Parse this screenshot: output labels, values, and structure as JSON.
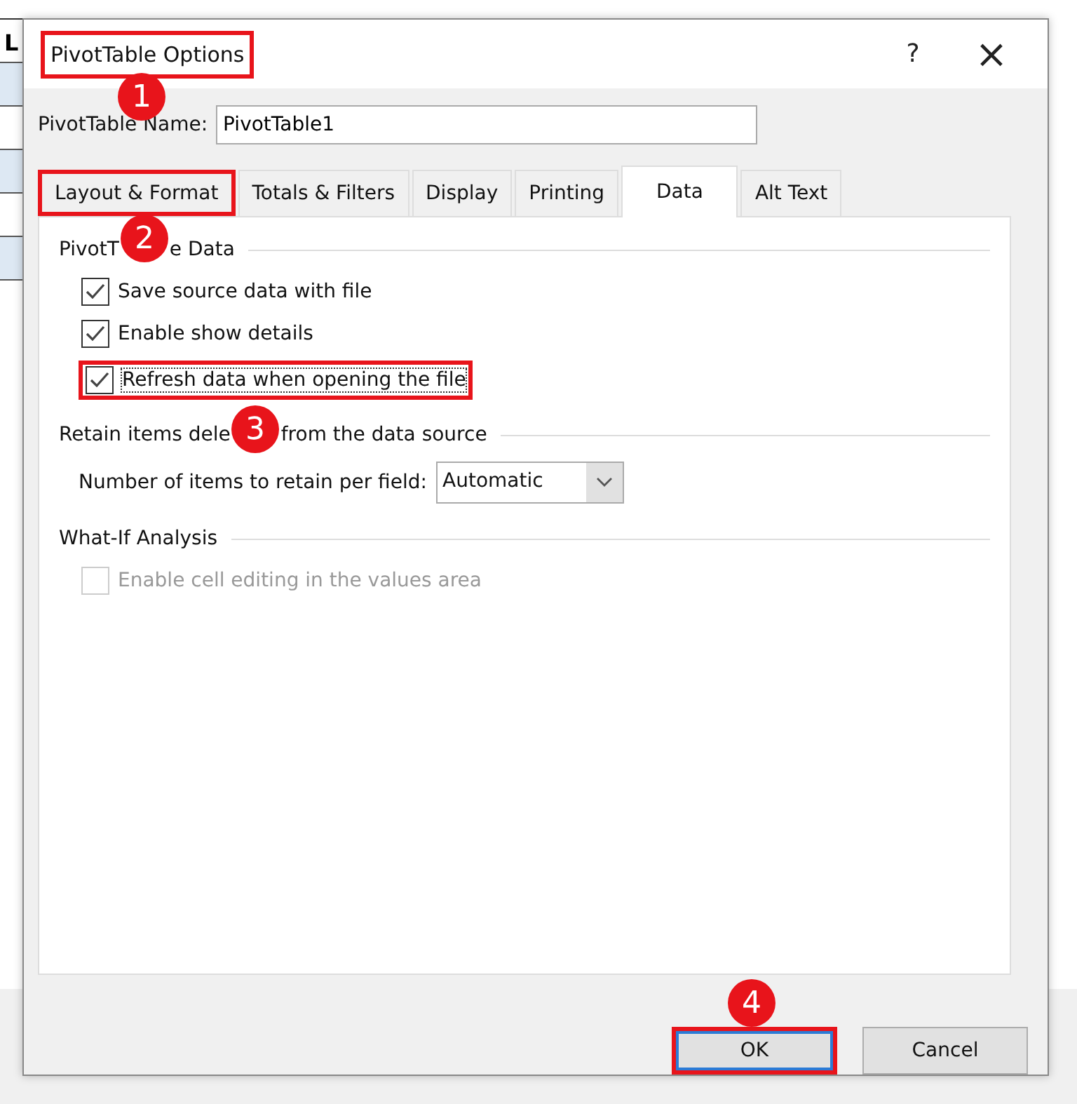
{
  "sheet": {
    "header_cell": "L"
  },
  "dialog": {
    "title": "PivotTable Options",
    "title_highlighted": true,
    "help": "?",
    "close": "×",
    "name_label": "PivotTable Name:",
    "name_value": "PivotTable1",
    "tabs": [
      {
        "label": "Layout & Format",
        "selected": false,
        "highlighted": true
      },
      {
        "label": "Totals & Filters",
        "selected": false,
        "highlighted": false
      },
      {
        "label": "Display",
        "selected": false,
        "highlighted": false
      },
      {
        "label": "Printing",
        "selected": false,
        "highlighted": false
      },
      {
        "label": "Data",
        "selected": true,
        "highlighted": false
      },
      {
        "label": "Alt Text",
        "selected": false,
        "highlighted": false
      }
    ],
    "sections": [
      {
        "title_parts": [
          "PivotT",
          "e Data"
        ],
        "items": [
          {
            "kind": "checkbox",
            "label": "Save source data with file",
            "checked": true,
            "disabled": false,
            "focused": false,
            "highlighted": false
          },
          {
            "kind": "checkbox",
            "label": "Enable show details",
            "checked": true,
            "disabled": false,
            "focused": false,
            "highlighted": false
          },
          {
            "kind": "checkbox",
            "label": "Refresh data when opening the file",
            "checked": true,
            "disabled": false,
            "focused": true,
            "highlighted": true
          }
        ]
      },
      {
        "title_parts": [
          "Retain items dele",
          "from the data source"
        ],
        "items": [
          {
            "kind": "dropdown",
            "label": "Number of items to retain per field:",
            "value": "Automatic"
          }
        ]
      },
      {
        "title_parts": [
          "What-If Analysis"
        ],
        "items": [
          {
            "kind": "checkbox",
            "label": "Enable cell editing in the values area",
            "checked": false,
            "disabled": true,
            "focused": false,
            "highlighted": false
          }
        ]
      }
    ],
    "buttons": [
      {
        "label": "OK",
        "default": true,
        "highlighted": true
      },
      {
        "label": "Cancel",
        "default": false,
        "highlighted": false
      }
    ]
  },
  "annotations": [
    {
      "number": "1"
    },
    {
      "number": "2"
    },
    {
      "number": "3"
    },
    {
      "number": "4"
    }
  ]
}
